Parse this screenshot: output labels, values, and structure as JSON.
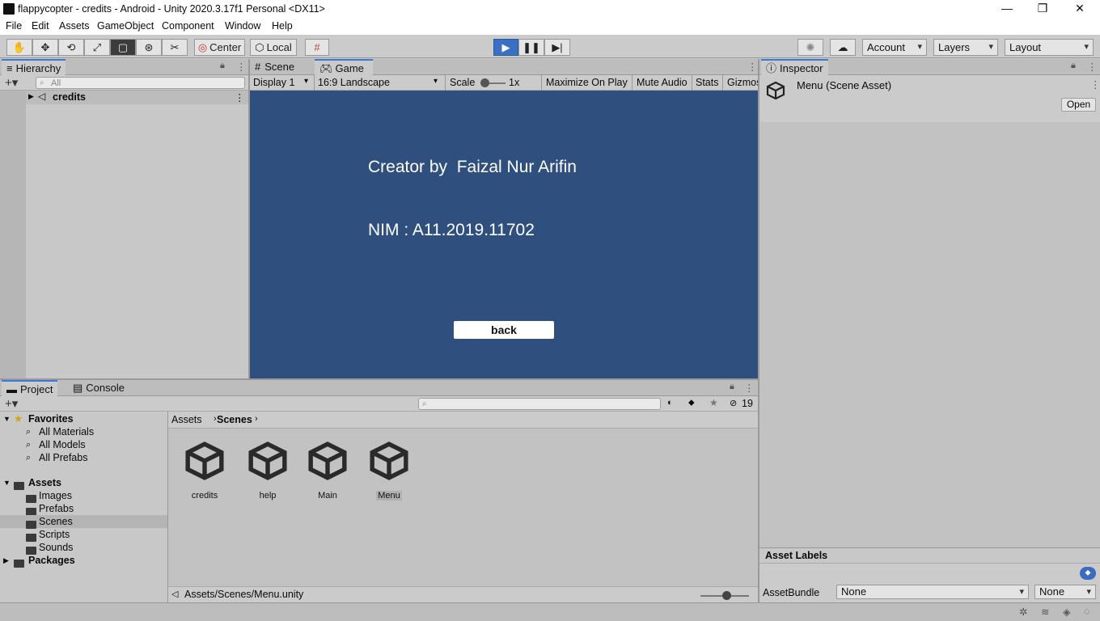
{
  "window": {
    "title": "flappycopter - credits - Android - Unity 2020.3.17f1 Personal <DX11>",
    "controls": {
      "minimize": "—",
      "maximize": "❐",
      "close": "✕"
    }
  },
  "menu": [
    "File",
    "Edit",
    "Assets",
    "GameObject",
    "Component",
    "Window",
    "Help"
  ],
  "toolbar": {
    "pivot_label": "Center",
    "space_label": "Local",
    "account_label": "Account",
    "layers_label": "Layers",
    "layout_label": "Layout",
    "play_state": "playing"
  },
  "hierarchy": {
    "tab_label": "Hierarchy",
    "search_placeholder": "All",
    "scene_name": "credits"
  },
  "scene_tabs": {
    "scene_label": "Scene",
    "game_label": "Game"
  },
  "game_toolbar": {
    "display": "Display 1",
    "aspect": "16:9 Landscape",
    "scale_label": "Scale",
    "scale_value": "1x",
    "maximize_label": "Maximize On Play",
    "mute_label": "Mute Audio",
    "stats_label": "Stats",
    "gizmos_label": "Gizmos"
  },
  "game_view": {
    "background": "#2f4f7e",
    "line1": "Creator by  Faizal Nur Arifin",
    "line2": "NIM : A11.2019.11702",
    "button_label": "back"
  },
  "inspector": {
    "tab_label": "Inspector",
    "asset_title": "Menu (Scene Asset)",
    "open_label": "Open",
    "labels_header": "Asset Labels",
    "assetbundle_label": "AssetBundle",
    "assetbundle_value": "None",
    "variant_value": "None"
  },
  "project": {
    "tab_project": "Project",
    "tab_console": "Console",
    "hidden_count": "19",
    "favorites_label": "Favorites",
    "favorites": [
      "All Materials",
      "All Models",
      "All Prefabs"
    ],
    "assets_label": "Assets",
    "asset_folders": [
      "Images",
      "Prefabs",
      "Scenes",
      "Scripts",
      "Sounds"
    ],
    "packages_label": "Packages",
    "breadcrumb": [
      "Assets",
      "Scenes"
    ],
    "items": [
      "credits",
      "help",
      "Main",
      "Menu"
    ],
    "selected_item": "Menu",
    "selected_folder": "Scenes",
    "footer_path": "Assets/Scenes/Menu.unity"
  }
}
